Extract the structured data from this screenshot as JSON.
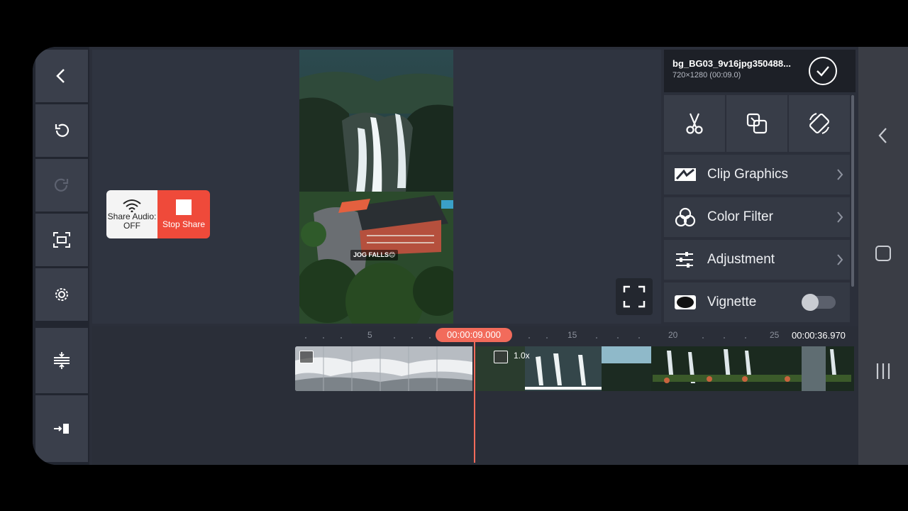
{
  "share": {
    "audio_label_line1": "Share Audio:",
    "audio_label_line2": "OFF",
    "stop_label": "Stop Share"
  },
  "video": {
    "caption": "JOG FALLS😊"
  },
  "right_panel": {
    "file_name": "bg_BG03_9v16jpg350488...",
    "file_meta": "720×1280 (00:09.0)",
    "tools": [
      "scissors-icon",
      "crop-layer-icon",
      "rotate-icon"
    ],
    "menu": [
      {
        "label": "Clip Graphics",
        "icon": "clip-graphics-icon"
      },
      {
        "label": "Color Filter",
        "icon": "color-filter-icon"
      },
      {
        "label": "Adjustment",
        "icon": "adjustment-sliders-icon"
      },
      {
        "label": "Vignette",
        "icon": "vignette-icon",
        "toggle": false
      }
    ]
  },
  "timeline": {
    "playhead_time": "00:00:09.000",
    "total_time": "00:00:36.970",
    "ruler_labels": [
      "5",
      "15",
      "20",
      "25"
    ],
    "clip_speed": "1.0x"
  },
  "colors": {
    "accent": "#f26b5b",
    "stop_red": "#ef4a3a",
    "panel_bg": "#2b2f3a"
  }
}
